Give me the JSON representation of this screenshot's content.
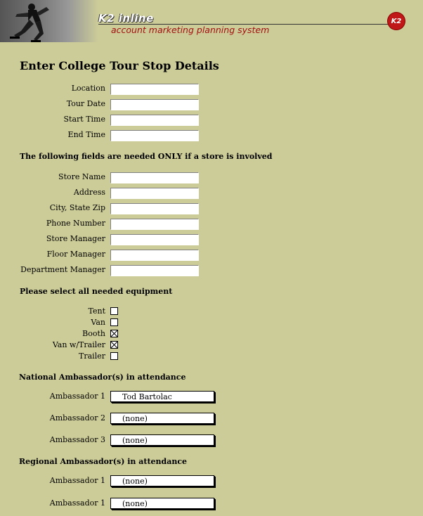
{
  "header": {
    "brand_title": "K2 inline",
    "brand_subtitle": "account marketing planning system",
    "logo_text": "K2",
    "logo_color": "#c01818",
    "subtitle_color": "#a31010"
  },
  "page_title": "Enter College Tour Stop Details",
  "tour_fields": [
    {
      "label": "Location",
      "value": ""
    },
    {
      "label": "Tour Date",
      "value": ""
    },
    {
      "label": "Start Time",
      "value": ""
    },
    {
      "label": "End Time",
      "value": ""
    }
  ],
  "store_section_heading": "The following fields are needed ONLY if a store is involved",
  "store_fields": [
    {
      "label": "Store Name",
      "value": ""
    },
    {
      "label": "Address",
      "value": ""
    },
    {
      "label": "City, State Zip",
      "value": ""
    },
    {
      "label": "Phone Number",
      "value": ""
    },
    {
      "label": "Store Manager",
      "value": ""
    },
    {
      "label": "Floor Manager",
      "value": ""
    },
    {
      "label": "Department Manager",
      "value": ""
    }
  ],
  "equipment_heading": "Please select all needed equipment",
  "equipment": [
    {
      "label": "Tent",
      "checked": false
    },
    {
      "label": "Van",
      "checked": false
    },
    {
      "label": "Booth",
      "checked": true
    },
    {
      "label": "Van w/Trailer",
      "checked": true
    },
    {
      "label": "Trailer",
      "checked": false
    }
  ],
  "national_heading": "National Ambassador(s) in attendance",
  "national_ambassadors": [
    {
      "label": "Ambassador 1",
      "selected": "Tod Bartolac"
    },
    {
      "label": "Ambassador 2",
      "selected": "(none)"
    },
    {
      "label": "Ambassador 3",
      "selected": "(none)"
    }
  ],
  "regional_heading": "Regional Ambassador(s) in attendance",
  "regional_ambassadors": [
    {
      "label": "Ambassador 1",
      "selected": "(none)"
    },
    {
      "label": "Ambassador 1",
      "selected": "(none)"
    }
  ],
  "colors": {
    "background": "#cccc99"
  }
}
